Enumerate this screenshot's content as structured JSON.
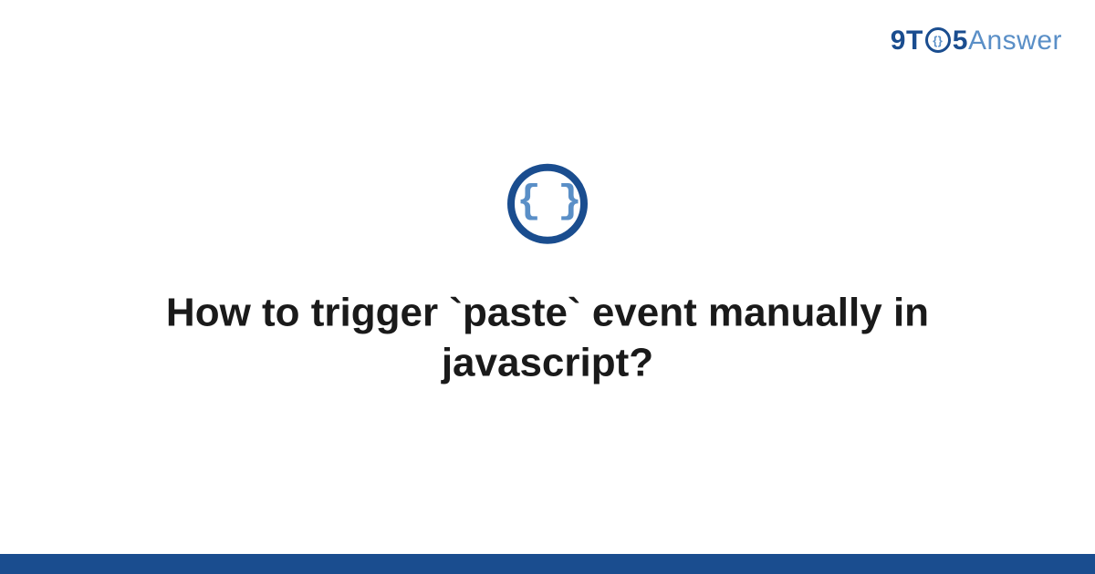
{
  "logo": {
    "nine": "9",
    "t": "T",
    "clock_inner": "{}",
    "five": "5",
    "answer": "Answer"
  },
  "icon": {
    "braces": "{ }"
  },
  "title": "How to trigger `paste` event manually in javascript?",
  "colors": {
    "primary": "#1a4d8f",
    "secondary": "#5a8fc7",
    "text": "#1a1a1a"
  }
}
